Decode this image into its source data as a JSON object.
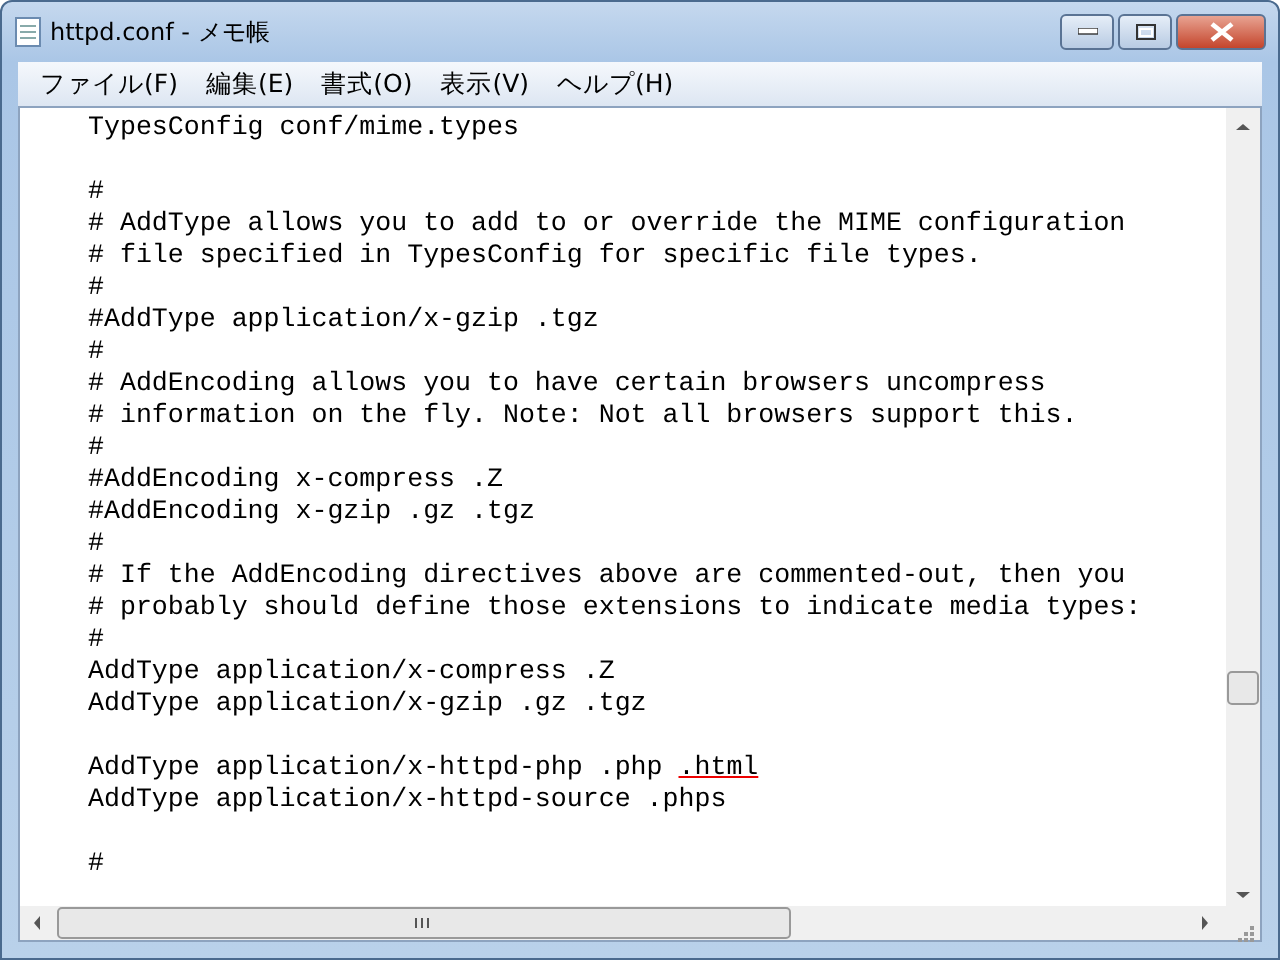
{
  "window": {
    "title": "httpd.conf - メモ帳"
  },
  "menu": [
    {
      "label": "ファイル(F)"
    },
    {
      "label": "編集(E)"
    },
    {
      "label": "書式(O)"
    },
    {
      "label": "表示(V)"
    },
    {
      "label": "ヘルプ(H)"
    }
  ],
  "lines": [
    {
      "kind": "text",
      "text": "TypesConfig conf/mime.types"
    },
    {
      "kind": "blank"
    },
    {
      "kind": "text",
      "text": "#"
    },
    {
      "kind": "text",
      "text": "# AddType allows you to add to or override the MIME configuration"
    },
    {
      "kind": "text",
      "text": "# file specified in TypesConfig for specific file types."
    },
    {
      "kind": "text",
      "text": "#"
    },
    {
      "kind": "text",
      "text": "#AddType application/x-gzip .tgz"
    },
    {
      "kind": "text",
      "text": "#"
    },
    {
      "kind": "text",
      "text": "# AddEncoding allows you to have certain browsers uncompress"
    },
    {
      "kind": "text",
      "text": "# information on the fly. Note: Not all browsers support this."
    },
    {
      "kind": "text",
      "text": "#"
    },
    {
      "kind": "text",
      "text": "#AddEncoding x-compress .Z"
    },
    {
      "kind": "text",
      "text": "#AddEncoding x-gzip .gz .tgz"
    },
    {
      "kind": "text",
      "text": "#"
    },
    {
      "kind": "text",
      "text": "# If the AddEncoding directives above are commented-out, then you"
    },
    {
      "kind": "text",
      "text": "# probably should define those extensions to indicate media types:"
    },
    {
      "kind": "text",
      "text": "#"
    },
    {
      "kind": "text",
      "text": "AddType application/x-compress .Z"
    },
    {
      "kind": "text",
      "text": "AddType application/x-gzip .gz .tgz"
    },
    {
      "kind": "blank"
    },
    {
      "kind": "text",
      "text": "AddType application/x-httpd-php .php ",
      "marked_text": ".html"
    },
    {
      "kind": "text",
      "text": "AddType application/x-httpd-source .phps"
    },
    {
      "kind": "blank"
    },
    {
      "kind": "text",
      "text": "#"
    }
  ]
}
